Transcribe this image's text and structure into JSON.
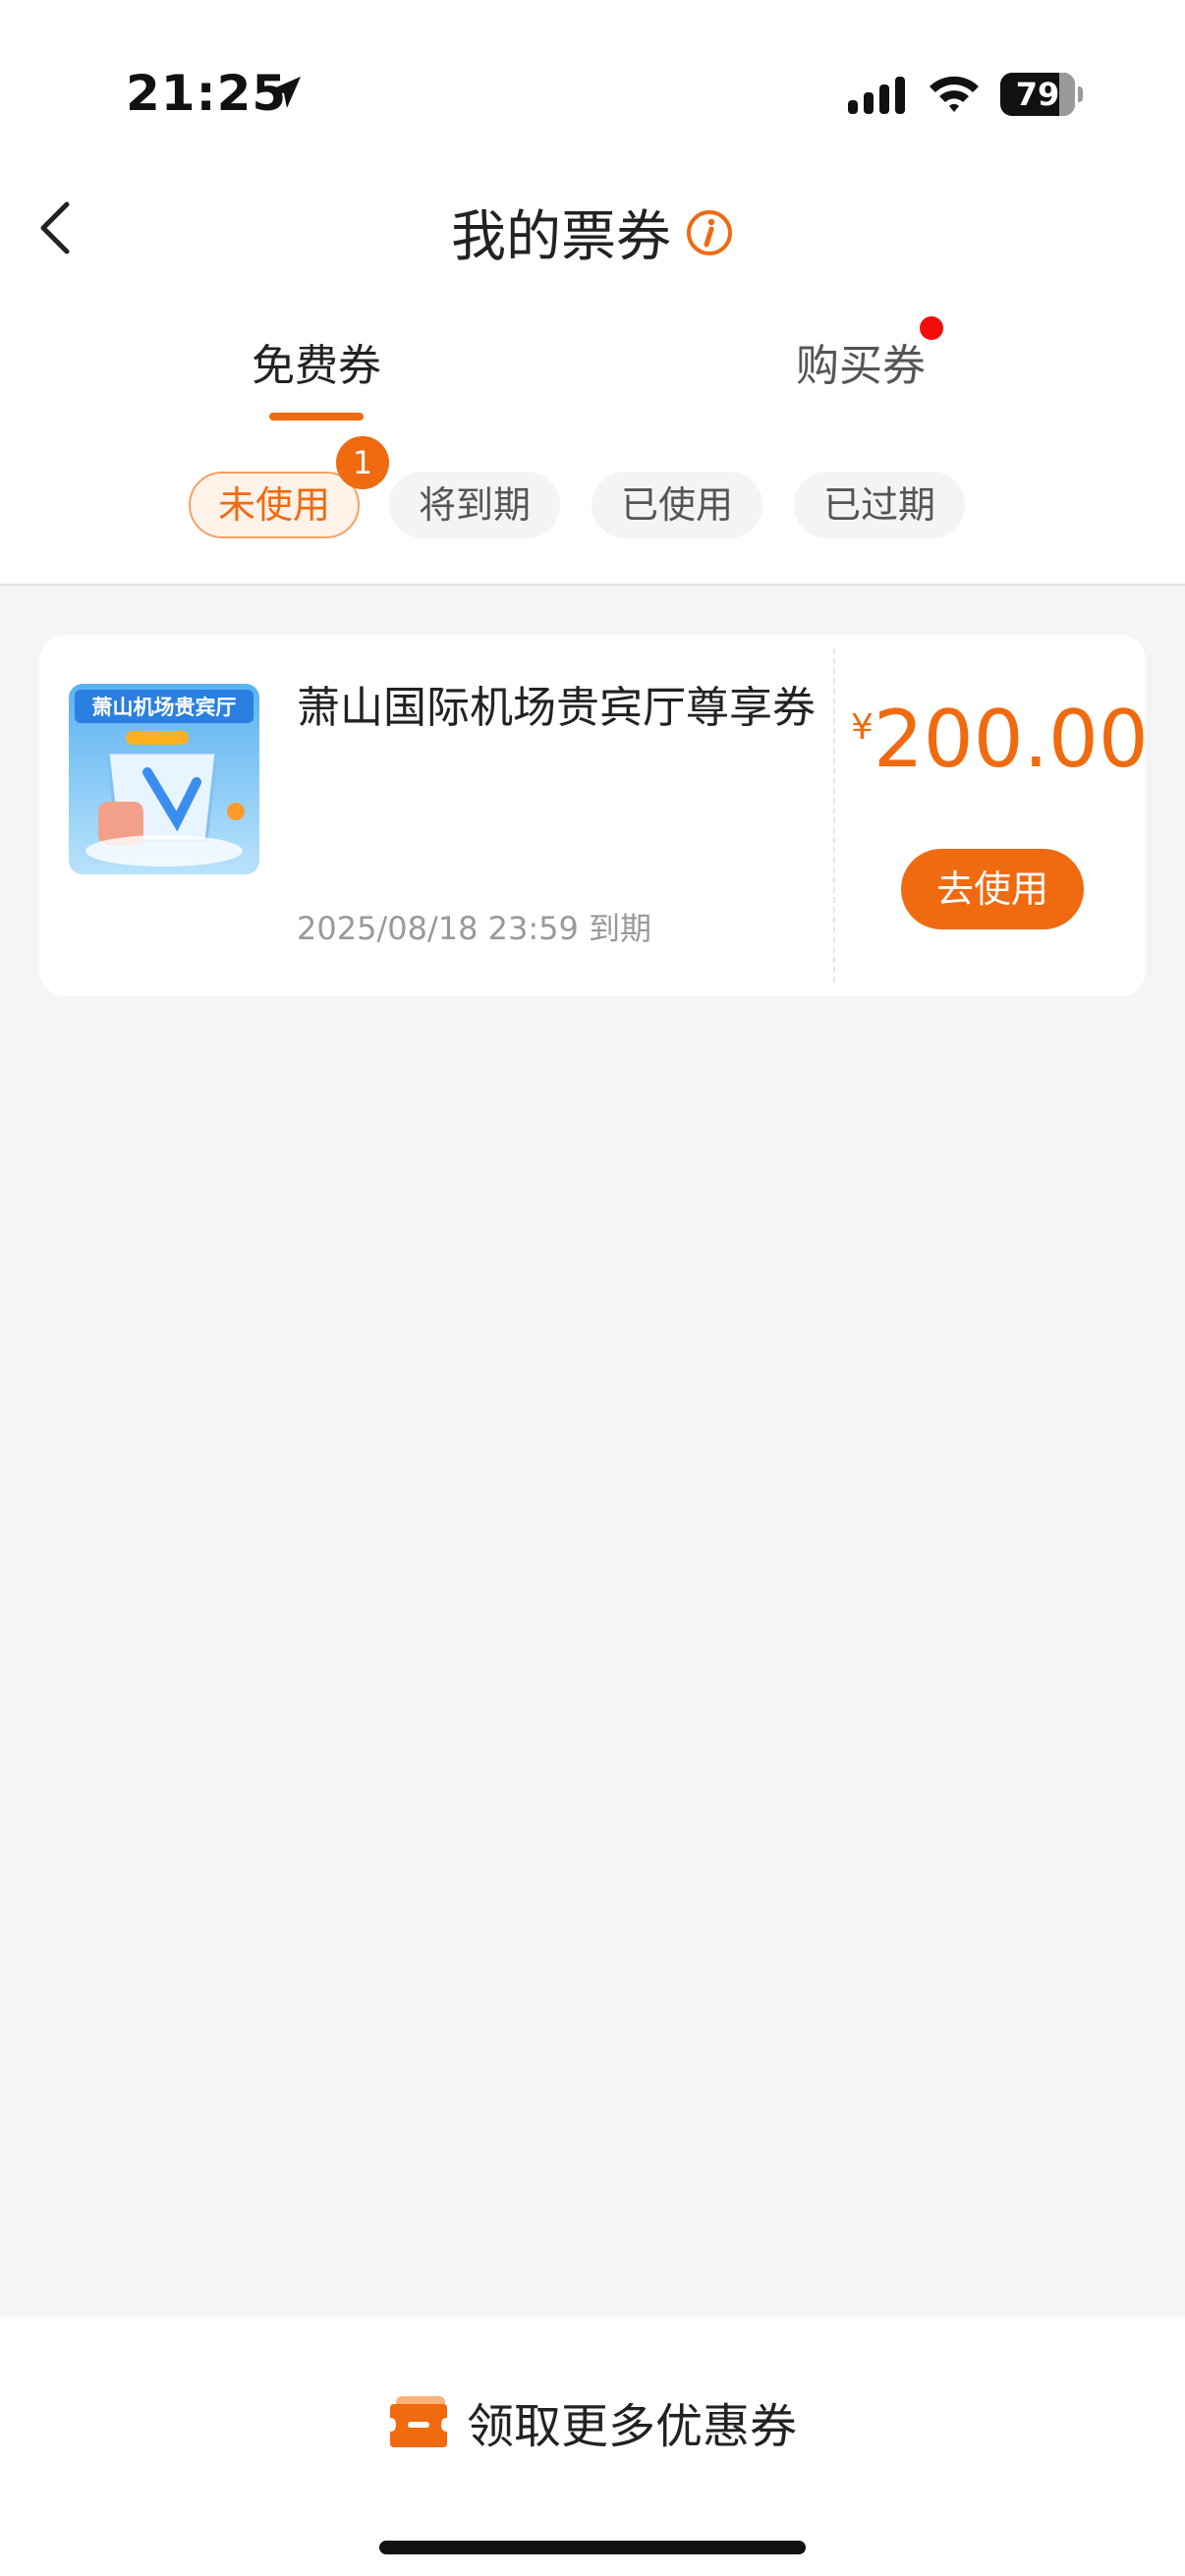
{
  "status_bar": {
    "time": "21:25",
    "battery": "79"
  },
  "nav": {
    "title": "我的票券"
  },
  "tabs": [
    {
      "label": "免费券",
      "active": true
    },
    {
      "label": "购买券",
      "active": false,
      "has_dot": true
    }
  ],
  "filters": [
    {
      "label": "未使用",
      "active": true,
      "badge": "1"
    },
    {
      "label": "将到期",
      "active": false
    },
    {
      "label": "已使用",
      "active": false
    },
    {
      "label": "已过期",
      "active": false
    }
  ],
  "coupons": [
    {
      "thumb_title": "萧山机场贵宾厅",
      "name": "萧山国际机场贵宾厅尊享券",
      "expiry": "2025/08/18 23:59 到期",
      "currency": "¥",
      "amount": "200.00",
      "action": "去使用"
    }
  ],
  "footer": {
    "get_more": "领取更多优惠券"
  },
  "colors": {
    "accent": "#f06a10",
    "red_dot": "#f20d0d",
    "background": "#f5f5f5"
  }
}
